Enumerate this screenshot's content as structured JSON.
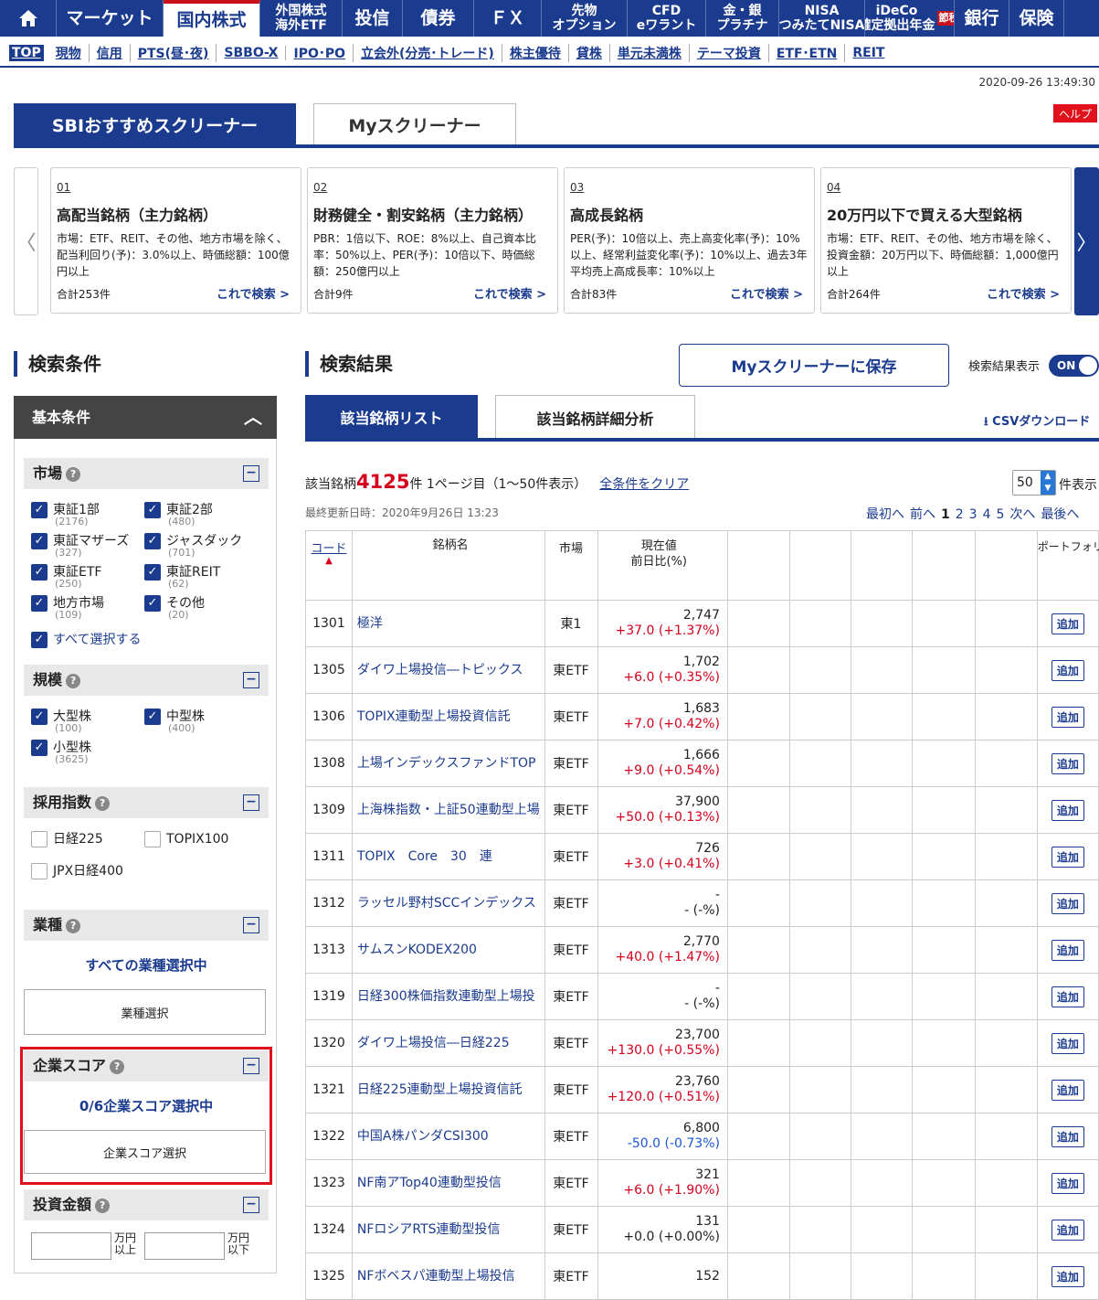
{
  "nav": {
    "home": "home",
    "items": [
      {
        "label": "マーケット",
        "w": 117
      },
      {
        "label": "国内株式",
        "w": 106,
        "active": true
      },
      {
        "label": "外国株式\n海外ETF",
        "w": 90
      },
      {
        "label": "投信",
        "w": 66
      },
      {
        "label": "債券",
        "w": 78
      },
      {
        "label": "ＦＸ",
        "w": 74
      },
      {
        "label": "先物\nオプション",
        "w": 94
      },
      {
        "label": "CFD\neワラント",
        "w": 86
      },
      {
        "label": "金・銀\nプラチナ",
        "w": 80
      },
      {
        "label": "NISA\nつみたてNISA",
        "w": 94
      },
      {
        "label": "iDeCo\n確定拠出年金",
        "w": 98,
        "tag": "節税"
      },
      {
        "label": "銀行",
        "w": 60
      },
      {
        "label": "保険",
        "w": 60
      }
    ]
  },
  "subnav": [
    "TOP",
    "現物",
    "信用",
    "PTS(昼･夜)",
    "SBBO-X",
    "IPO･PO",
    "立会外(分売･トレード)",
    "株主優待",
    "貸株",
    "単元未満株",
    "テーマ投資",
    "ETF･ETN",
    "REIT"
  ],
  "datetime": "2020-09-26 13:49:30",
  "tabs": {
    "sbi": "SBIおすすめスクリーナー",
    "my": "Myスクリーナー",
    "help": "ヘルプ"
  },
  "cards": [
    {
      "num": "01",
      "title": "高配当銘柄（主力銘柄）",
      "desc": "市場：ETF、REIT、その他、地方市場を除く、配当利回り(予)：3.0%以上、時価総額：100億円以上",
      "total": "合計253件",
      "go": "これで検索 >"
    },
    {
      "num": "02",
      "title": "財務健全・割安銘柄（主力銘柄）",
      "desc": "PBR：1倍以下、ROE：8%以上、自己資本比率：50%以上、PER(予)：10倍以下、時価総額：250億円以上",
      "total": "合計9件",
      "go": "これで検索 >"
    },
    {
      "num": "03",
      "title": "高成長銘柄",
      "desc": "PER(予)：10倍以上、売上高変化率(予)：10%以上、経常利益変化率(予)：10%以上、過去3年平均売上高成長率：10%以上",
      "total": "合計83件",
      "go": "これで検索 >"
    },
    {
      "num": "04",
      "title": "20万円以下で買える大型銘柄",
      "desc": "市場：ETF、REIT、その他、地方市場を除く、投資金額：20万円以下、時価総額：1,000億円以上",
      "total": "合計264件",
      "go": "これで検索 >"
    }
  ],
  "left": {
    "title": "検索条件",
    "basic": "基本条件",
    "market": {
      "label": "市場",
      "items": [
        {
          "label": "東証1部",
          "count": "(2176)"
        },
        {
          "label": "東証2部",
          "count": "(480)"
        },
        {
          "label": "東証マザーズ",
          "count": "(327)"
        },
        {
          "label": "ジャスダック",
          "count": "(701)"
        },
        {
          "label": "東証ETF",
          "count": "(250)"
        },
        {
          "label": "東証REIT",
          "count": "(62)"
        },
        {
          "label": "地方市場",
          "count": "(109)"
        },
        {
          "label": "その他",
          "count": "(20)"
        }
      ],
      "all": "すべて選択する"
    },
    "scale": {
      "label": "規模",
      "items": [
        {
          "label": "大型株",
          "count": "(100)"
        },
        {
          "label": "中型株",
          "count": "(400)"
        },
        {
          "label": "小型株",
          "count": "(3625)"
        }
      ]
    },
    "index": {
      "label": "採用指数",
      "items": [
        "日経225",
        "TOPIX100",
        "JPX日経400"
      ]
    },
    "industry": {
      "label": "業種",
      "status": "すべての業種選択中",
      "button": "業種選択"
    },
    "score": {
      "label": "企業スコア",
      "status": "0/6企業スコア選択中",
      "button": "企業スコア選択"
    },
    "invest": {
      "label": "投資金額",
      "above": "万円以上",
      "below": "万円以下"
    }
  },
  "right": {
    "title": "検索結果",
    "save": "Myスクリーナーに保存",
    "toggle_label": "検索結果表示",
    "toggle": "ON",
    "tab_list": "該当銘柄リスト",
    "tab_detail": "該当銘柄詳細分析",
    "csv": "CSVダウンロード",
    "count_prefix": "該当銘柄",
    "count": "4125",
    "count_suffix": "件 1ページ目（1～50件表示）",
    "clear": "全条件をクリア",
    "perpage": "50",
    "perpage_label": "件表示",
    "updated": "最終更新日時：2020年9月26日 13:23",
    "pager": {
      "first": "最初へ",
      "prev": "前へ",
      "pages": [
        "1",
        "2",
        "3",
        "4",
        "5"
      ],
      "next": "次へ",
      "last": "最後へ"
    },
    "headers": {
      "code": "コード",
      "name": "銘柄名",
      "market": "市場",
      "price": "現在値",
      "change": "前日比(%)",
      "portfolio": "ポートフォリオ"
    },
    "add": "追加",
    "rows": [
      {
        "code": "1301",
        "name": "極洋",
        "market": "東1",
        "price": "2,747",
        "change": "+37.0 (+1.37%)",
        "dir": "up"
      },
      {
        "code": "1305",
        "name": "ダイワ上場投信―トピックス",
        "market": "東ETF",
        "price": "1,702",
        "change": "+6.0 (+0.35%)",
        "dir": "up"
      },
      {
        "code": "1306",
        "name": "TOPIX連動型上場投資信託",
        "market": "東ETF",
        "price": "1,683",
        "change": "+7.0 (+0.42%)",
        "dir": "up"
      },
      {
        "code": "1308",
        "name": "上場インデックスファンドTOP",
        "market": "東ETF",
        "price": "1,666",
        "change": "+9.0 (+0.54%)",
        "dir": "up"
      },
      {
        "code": "1309",
        "name": "上海株指数・上証50連動型上場",
        "market": "東ETF",
        "price": "37,900",
        "change": "+50.0 (+0.13%)",
        "dir": "up"
      },
      {
        "code": "1311",
        "name": "TOPIX　Core　30　連",
        "market": "東ETF",
        "price": "726",
        "change": "+3.0 (+0.41%)",
        "dir": "up"
      },
      {
        "code": "1312",
        "name": "ラッセル野村SCCインデックス",
        "market": "東ETF",
        "price": "-",
        "change": "- (-%)",
        "dir": "nt"
      },
      {
        "code": "1313",
        "name": "サムスンKODEX200",
        "market": "東ETF",
        "price": "2,770",
        "change": "+40.0 (+1.47%)",
        "dir": "up"
      },
      {
        "code": "1319",
        "name": "日経300株価指数連動型上場投",
        "market": "東ETF",
        "price": "-",
        "change": "- (-%)",
        "dir": "nt"
      },
      {
        "code": "1320",
        "name": "ダイワ上場投信―日経225",
        "market": "東ETF",
        "price": "23,700",
        "change": "+130.0 (+0.55%)",
        "dir": "up"
      },
      {
        "code": "1321",
        "name": "日経225連動型上場投資信託",
        "market": "東ETF",
        "price": "23,760",
        "change": "+120.0 (+0.51%)",
        "dir": "up"
      },
      {
        "code": "1322",
        "name": "中国A株パンダCSI300",
        "market": "東ETF",
        "price": "6,800",
        "change": "-50.0 (-0.73%)",
        "dir": "dn"
      },
      {
        "code": "1323",
        "name": "NF南アTop40連動型投信",
        "market": "東ETF",
        "price": "321",
        "change": "+6.0 (+1.90%)",
        "dir": "up"
      },
      {
        "code": "1324",
        "name": "NFロシアRTS連動型投信",
        "market": "東ETF",
        "price": "131",
        "change": "+0.0 (+0.00%)",
        "dir": "nt"
      },
      {
        "code": "1325",
        "name": "NFボベスパ連動型上場投信",
        "market": "東ETF",
        "price": "152",
        "change": "",
        "dir": "nt"
      }
    ]
  }
}
